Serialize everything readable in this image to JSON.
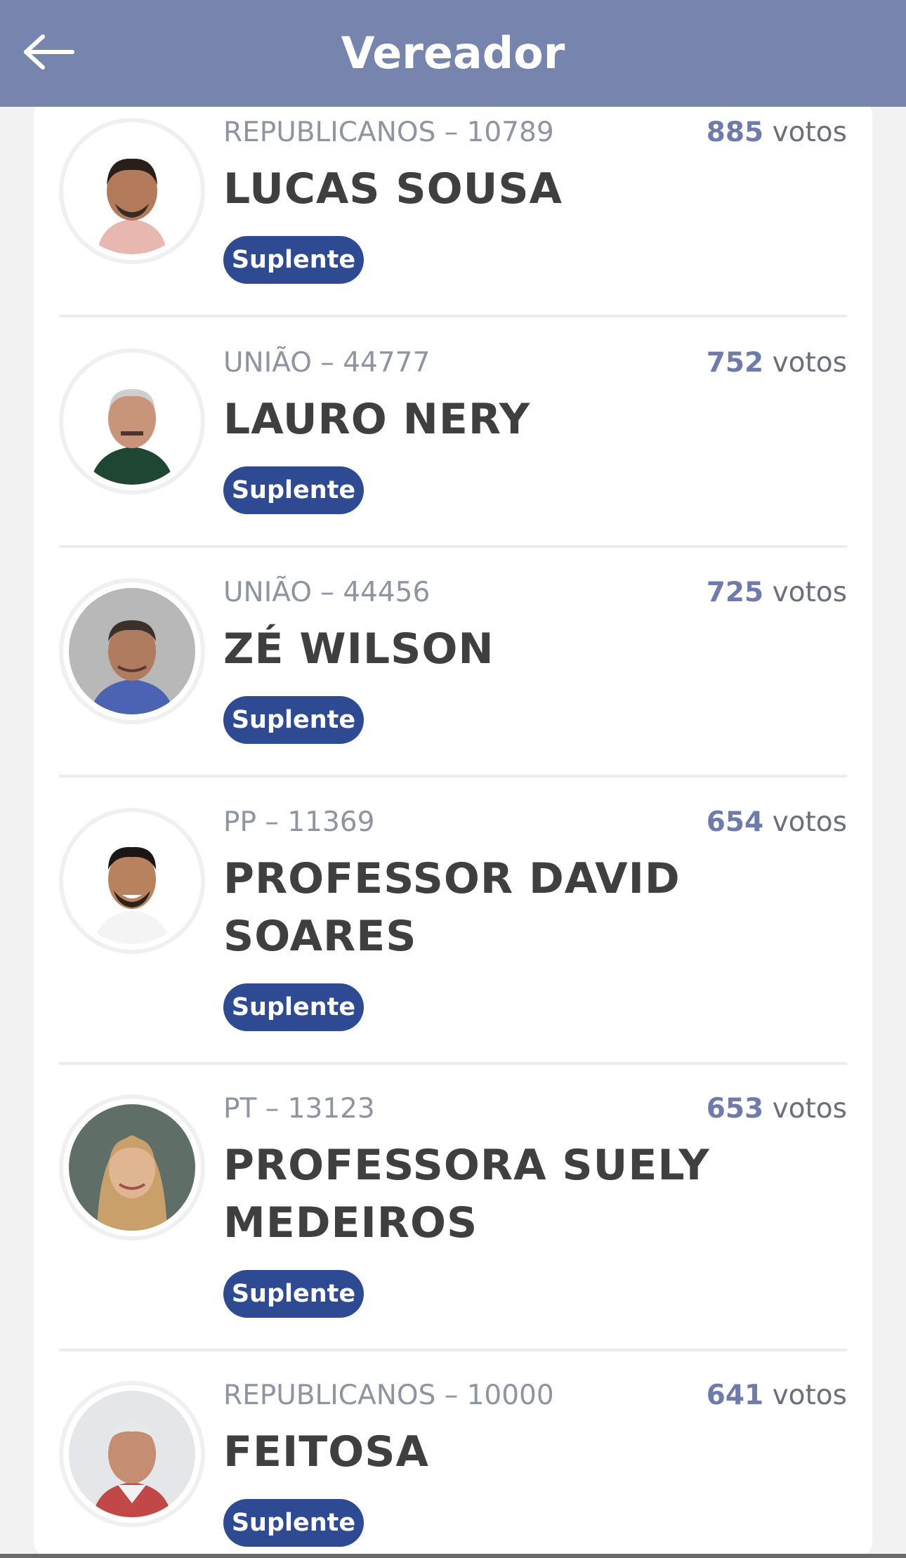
{
  "header": {
    "title": "Vereador",
    "back_icon": "arrow-left-icon",
    "background_color": "#7785ae"
  },
  "candidates": [
    {
      "party_line": "REPUBLICANOS – 10789",
      "name": "LUCAS SOUSA",
      "votes": "885",
      "votes_label": "votos",
      "status": "Suplente"
    },
    {
      "party_line": "UNIÃO – 44777",
      "name": "LAURO NERY",
      "votes": "752",
      "votes_label": "votos",
      "status": "Suplente"
    },
    {
      "party_line": "UNIÃO – 44456",
      "name": "ZÉ WILSON",
      "votes": "725",
      "votes_label": "votos",
      "status": "Suplente"
    },
    {
      "party_line": "PP – 11369",
      "name": "PROFESSOR DAVID SOARES",
      "votes": "654",
      "votes_label": "votos",
      "status": "Suplente"
    },
    {
      "party_line": "PT – 13123",
      "name": "PROFESSORA SUELY MEDEIROS",
      "votes": "653",
      "votes_label": "votos",
      "status": "Suplente"
    },
    {
      "party_line": "REPUBLICANOS – 10000",
      "name": "FEITOSA",
      "votes": "641",
      "votes_label": "votos",
      "status": "Suplente"
    }
  ],
  "colors": {
    "badge": "#2e4a93",
    "votes_number": "#6f7cab",
    "name_text": "#3f3f3f"
  }
}
